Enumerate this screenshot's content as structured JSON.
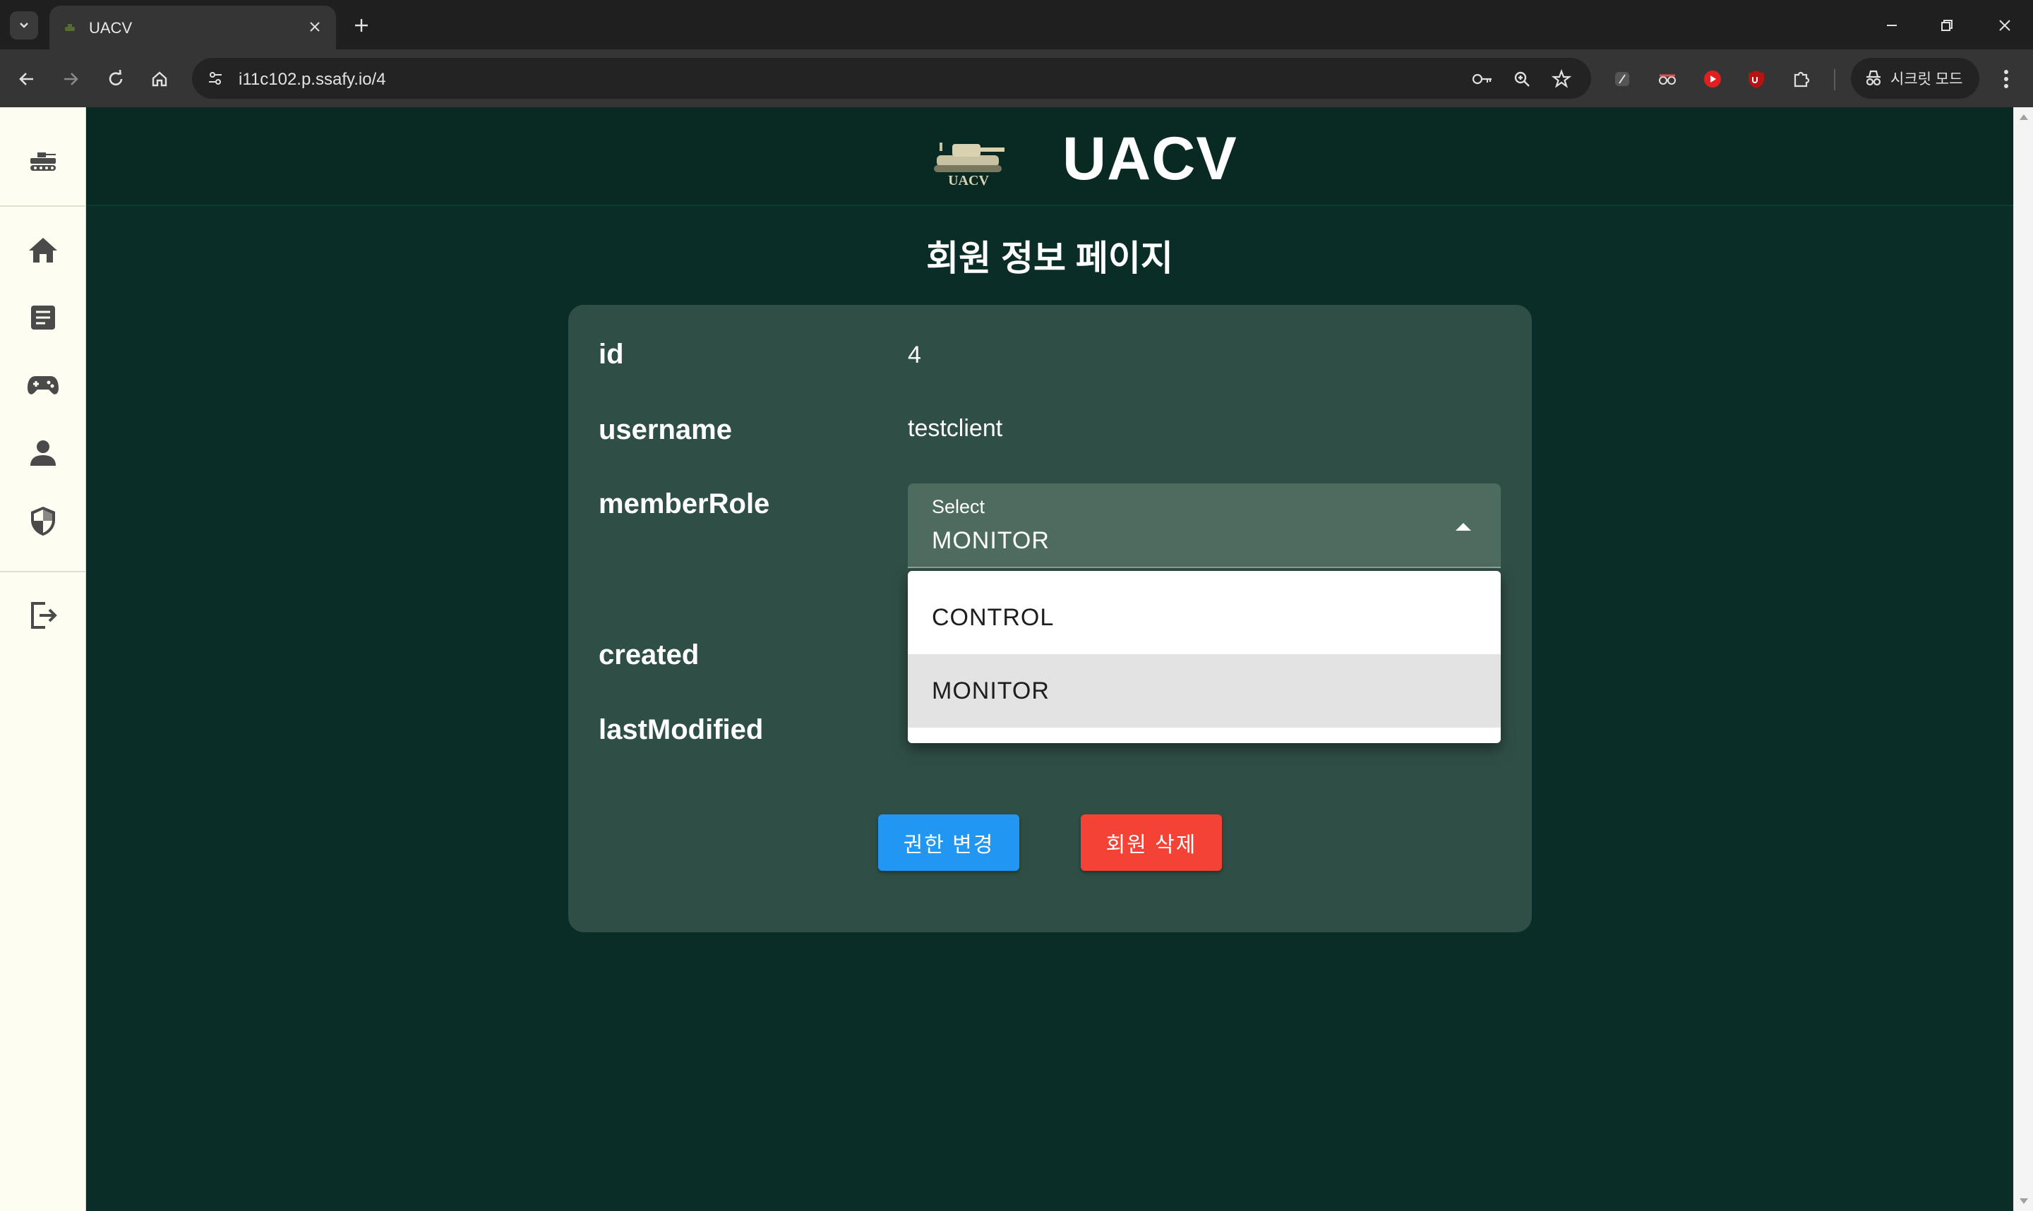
{
  "browser": {
    "tab_title": "UACV",
    "url": "i11c102.p.ssafy.io/4",
    "incognito_label": "시크릿 모드"
  },
  "app": {
    "brand": "UACV",
    "logo_text": "UACV"
  },
  "sidebar": {
    "items": [
      {
        "name": "tank-icon"
      },
      {
        "name": "home-icon"
      },
      {
        "name": "document-icon"
      },
      {
        "name": "gamepad-icon"
      },
      {
        "name": "person-icon"
      },
      {
        "name": "shield-icon"
      },
      {
        "name": "logout-icon"
      }
    ]
  },
  "page": {
    "title": "회원 정보 페이지"
  },
  "fields": {
    "id_label": "id",
    "id_value": "4",
    "username_label": "username",
    "username_value": "testclient",
    "role_label": "memberRole",
    "created_label": "created",
    "modified_label": "lastModified"
  },
  "role_select": {
    "label": "Select",
    "value": "MONITOR",
    "options": [
      "CONTROL",
      "MONITOR"
    ],
    "selected_index": 1
  },
  "actions": {
    "change_role": "권한 변경",
    "delete_member": "회원 삭제"
  },
  "colors": {
    "background": "#0a2e27",
    "card": "#2f4f46",
    "sidebar": "#fefdf1",
    "primary": "#2196f3",
    "danger": "#f44336"
  }
}
